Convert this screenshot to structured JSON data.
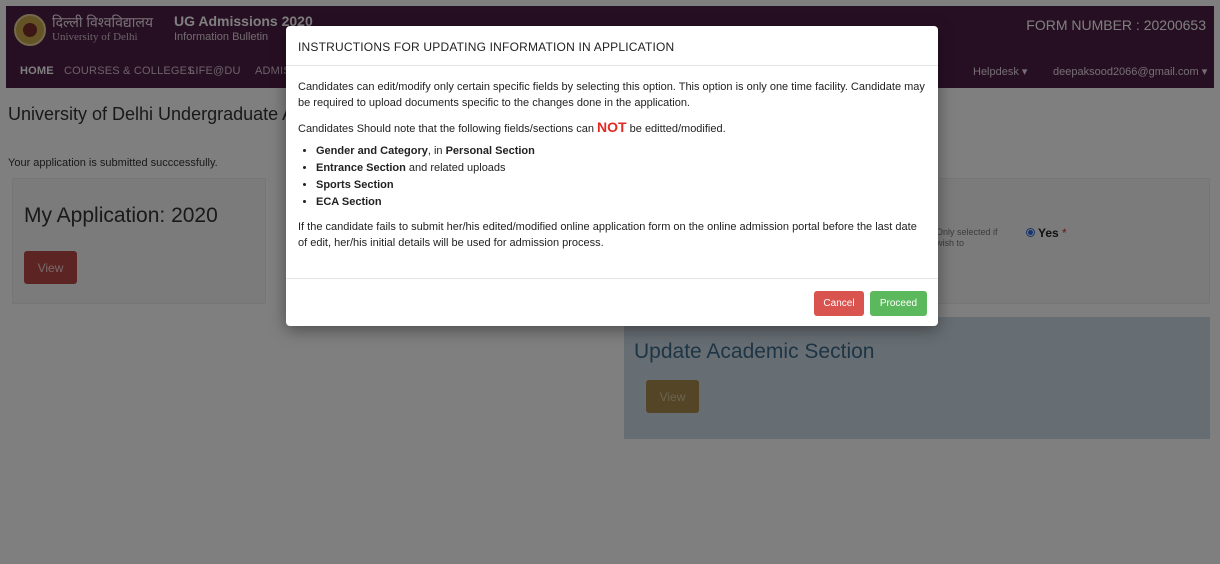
{
  "header": {
    "logo_hindi": "दिल्ली विश्वविद्यालय",
    "logo_english": "University of Delhi",
    "title": "UG Admissions 2020",
    "subtitle": "Information Bulletin",
    "form_number": "FORM NUMBER : 20200653",
    "nav": [
      "HOME",
      "COURSES & COLLEGES",
      "LIFE@DU",
      "ADMIS"
    ],
    "helpdesk": "Helpdesk ▾",
    "user_email": "deepaksood2066@gmail.com ▾"
  },
  "page": {
    "title": "University of Delhi Undergraduate A",
    "status": "Your application is submitted succcessfully."
  },
  "my_application": {
    "title": "My Application: 2020",
    "view_label": "View"
  },
  "right_card": {
    "note": "Only selected if wish to",
    "yes_label": "Yes",
    "required_mark": "*"
  },
  "academic": {
    "title": "Update Academic Section",
    "view_label": "View"
  },
  "modal": {
    "title": "INSTRUCTIONS FOR UPDATING INFORMATION IN APPLICATION",
    "para1": "Candidates can edit/modify only certain specific fields by selecting this option. This option is only one time facility. Candidate may be required to upload documents specific to the changes done in the application.",
    "para2_pre": "Candidates Should note that the following fields/sections can ",
    "para2_not": "NOT",
    "para2_post": " be editted/modified.",
    "items": [
      {
        "bold": "Gender and Category",
        "mid": ", in ",
        "bold2": "Personal Section",
        "rest": ""
      },
      {
        "bold": "Entrance Section",
        "mid": "",
        "bold2": "",
        "rest": " and related uploads"
      },
      {
        "bold": "Sports Section",
        "mid": "",
        "bold2": "",
        "rest": ""
      },
      {
        "bold": "ECA Section",
        "mid": "",
        "bold2": "",
        "rest": ""
      }
    ],
    "para3": "If the candidate fails to submit her/his edited/modified online application form on the online admission portal before the last date of edit, her/his initial details will be used for admission process.",
    "cancel_label": "Cancel",
    "proceed_label": "Proceed"
  },
  "colors": {
    "header_bg": "#4e1e46",
    "not_red": "#e22a25",
    "cancel_red": "#d9534f",
    "proceed_green": "#5cb85c"
  }
}
